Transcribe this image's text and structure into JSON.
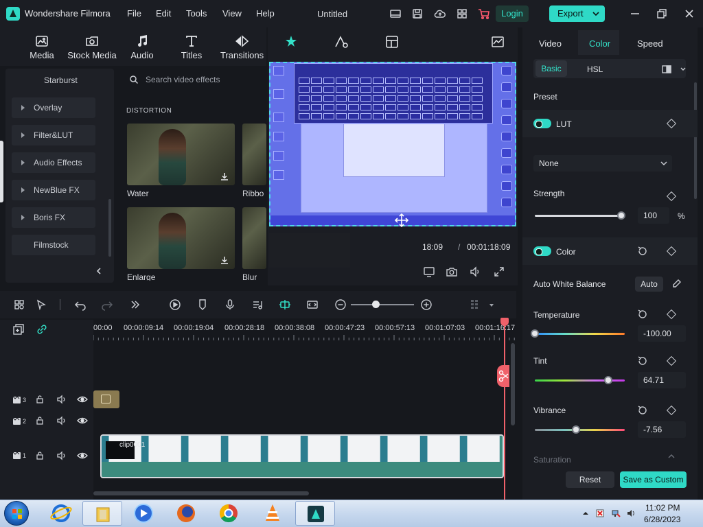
{
  "app": {
    "name": "Wondershare Filmora",
    "document_title": "Untitled",
    "menu": [
      "File",
      "Edit",
      "Tools",
      "View",
      "Help"
    ],
    "login_label": "Login",
    "export_label": "Export"
  },
  "media_toolbar": {
    "tabs": [
      {
        "label": "Media",
        "icon": "media-icon"
      },
      {
        "label": "Stock Media",
        "icon": "stock-media-icon"
      },
      {
        "label": "Audio",
        "icon": "music-note-icon"
      },
      {
        "label": "Titles",
        "icon": "titles-icon"
      },
      {
        "label": "Transitions",
        "icon": "transitions-icon"
      }
    ]
  },
  "effects_sidebar": {
    "header": "Starburst",
    "categories": [
      "Overlay",
      "Filter&LUT",
      "Audio Effects",
      "NewBlue FX",
      "Boris FX"
    ],
    "footer": "Filmstock"
  },
  "effects_grid": {
    "search_placeholder": "Search video effects",
    "section_title": "DISTORTION",
    "items": [
      "Water",
      "Ribbo",
      "Enlarge",
      "Blur"
    ]
  },
  "preview": {
    "current_time": "18:09",
    "separator": "/",
    "total_time": "00:01:18:09"
  },
  "right_panel": {
    "tabs": [
      "Video",
      "Color",
      "Speed"
    ],
    "active_tab": "Color",
    "sub_tabs": [
      "Basic",
      "HSL"
    ],
    "active_sub_tab": "Basic",
    "preset_label": "Preset",
    "lut_label": "LUT",
    "lut_value": "None",
    "strength_label": "Strength",
    "strength_value": "100",
    "strength_unit": "%",
    "strength_fraction": 1.0,
    "color_label": "Color",
    "auto_wb_label": "Auto White Balance",
    "auto_label": "Auto",
    "temperature_label": "Temperature",
    "temperature_value": "-100.00",
    "temperature_fraction": 0.0,
    "tint_label": "Tint",
    "tint_value": "64.71",
    "tint_fraction": 0.82,
    "vibrance_label": "Vibrance",
    "vibrance_value": "-7.56",
    "vibrance_fraction": 0.46,
    "saturation_label": "Saturation",
    "reset_label": "Reset",
    "save_custom_label": "Save as Custom"
  },
  "timeline": {
    "ruler_labels": [
      "00:00",
      "00:00:09:14",
      "00:00:19:04",
      "00:00:28:18",
      "00:00:38:08",
      "00:00:47:23",
      "00:00:57:13",
      "00:01:07:03",
      "00:01:16:17"
    ],
    "tracks": [
      "3",
      "2",
      "1"
    ],
    "clip_name": "clip0001"
  },
  "taskbar": {
    "time": "11:02 PM",
    "date": "6/28/2023"
  },
  "colors": {
    "accent": "#2fd9c6",
    "playhead": "#f0616a",
    "background": "#16181d"
  }
}
